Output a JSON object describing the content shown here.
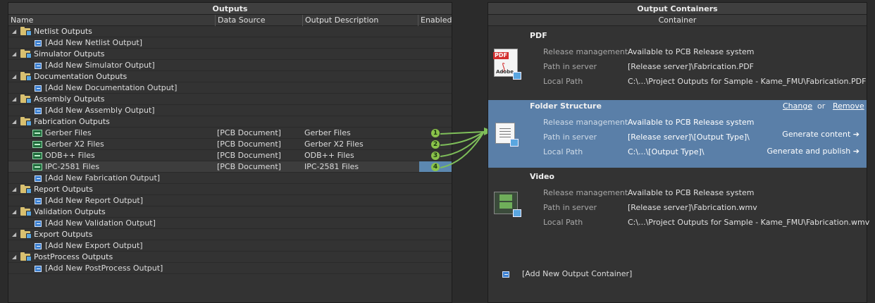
{
  "outputs": {
    "title": "Outputs",
    "columns": {
      "name": "Name",
      "data_source": "Data Source",
      "output_description": "Output Description",
      "enabled": "Enabled"
    },
    "groups": {
      "netlist": {
        "label": "Netlist Outputs",
        "add": "[Add New Netlist Output]"
      },
      "simulator": {
        "label": "Simulator Outputs",
        "add": "[Add New Simulator Output]"
      },
      "documentation": {
        "label": "Documentation Outputs",
        "add": "[Add New Documentation Output]"
      },
      "assembly": {
        "label": "Assembly Outputs",
        "add": "[Add New Assembly Output]"
      },
      "fabrication": {
        "label": "Fabrication Outputs",
        "items": [
          {
            "name": "Gerber Files",
            "source": "[PCB Document]",
            "description": "Gerber Files",
            "badge": "1"
          },
          {
            "name": "Gerber X2 Files",
            "source": "[PCB Document]",
            "description": "Gerber X2 Files",
            "badge": "2"
          },
          {
            "name": "ODB++ Files",
            "source": "[PCB Document]",
            "description": "ODB++ Files",
            "badge": "3"
          },
          {
            "name": "IPC-2581 Files",
            "source": "[PCB Document]",
            "description": "IPC-2581 Files",
            "badge": "4"
          }
        ],
        "add": "[Add New Fabrication Output]"
      },
      "report": {
        "label": "Report Outputs",
        "add": "[Add New Report Output]"
      },
      "validation": {
        "label": "Validation Outputs",
        "add": "[Add New Validation Output]"
      },
      "export": {
        "label": "Export Outputs",
        "add": "[Add New Export Output]"
      },
      "postprocess": {
        "label": "PostProcess Outputs",
        "add": "[Add New PostProcess Output]"
      }
    }
  },
  "containers": {
    "title": "Output Containers",
    "column": "Container",
    "field_labels": {
      "release": "Release management",
      "path": "Path in server",
      "local": "Local Path"
    },
    "pdf": {
      "name": "PDF",
      "icon": "pdf-document-icon",
      "release": "Available to PCB Release system",
      "path": "[Release server]\\Fabrication.PDF",
      "local": "C:\\...\\Project Outputs for Sample - Kame_FMU\\Fabrication.PDF",
      "icon_text": {
        "tag": "PDF",
        "adobe": "Adobe"
      }
    },
    "folder": {
      "name": "Folder Structure",
      "icon": "folder-structure-icon",
      "release": "Available to PCB Release system",
      "path": "[Release server]\\[Output Type]\\",
      "local": "C:\\...\\[Output Type]\\",
      "change": "Change",
      "or": "or",
      "remove": "Remove",
      "generate_content": "Generate content ➔",
      "generate_publish": "Generate and publish ➔"
    },
    "video": {
      "name": "Video",
      "icon": "video-icon",
      "release": "Available to PCB Release system",
      "path": "[Release server]\\Fabrication.wmv",
      "local": "C:\\...\\Project Outputs for Sample - Kame_FMU\\Fabrication.wmv"
    },
    "add": "[Add New Output Container]"
  },
  "colors": {
    "selection": "#5a7fa8",
    "badge": "#8bc34a",
    "connector": "#7fbf5a",
    "folder": "#d8c070"
  }
}
